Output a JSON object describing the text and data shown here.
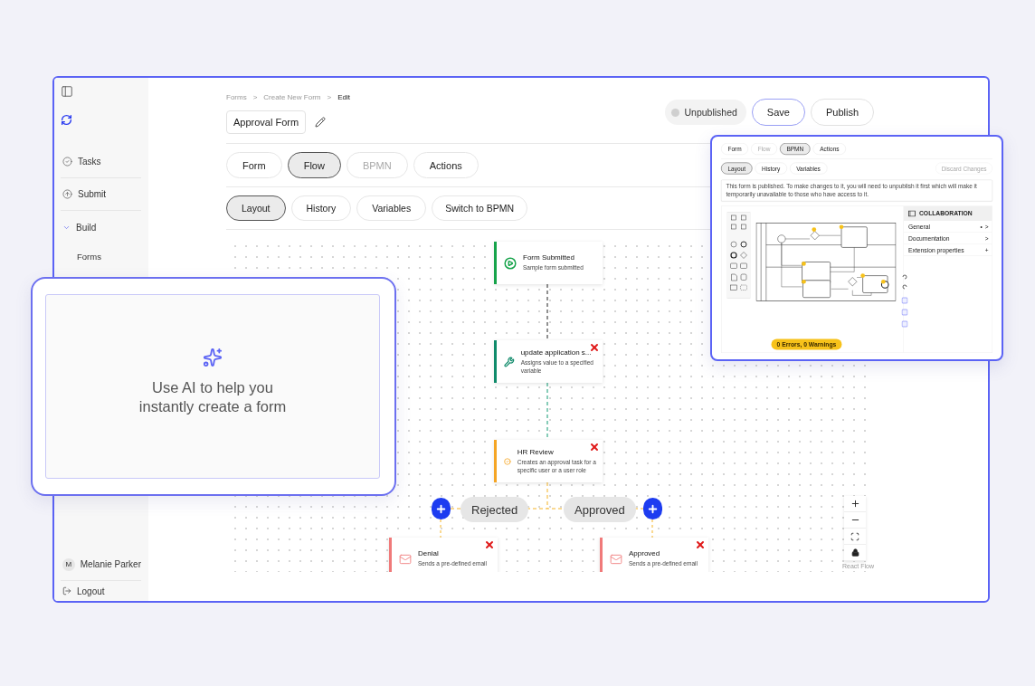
{
  "sidebar": {
    "items": [
      {
        "label": "Tasks"
      },
      {
        "label": "Submit"
      },
      {
        "label": "Build",
        "expanded": true,
        "children": [
          {
            "label": "Forms"
          }
        ]
      }
    ],
    "user": {
      "initial": "M",
      "name": "Melanie Parker"
    },
    "logout": "Logout"
  },
  "breadcrumb": {
    "items": [
      "Forms",
      "Create New Form",
      "Edit"
    ],
    "separator": ">"
  },
  "form_name": "Approval Form",
  "status": {
    "label": "Unpublished",
    "published": false
  },
  "buttons": [
    "Save",
    "Publish"
  ],
  "tabs": [
    {
      "label": "Form",
      "selected": false,
      "disabled": false
    },
    {
      "label": "Flow",
      "selected": true,
      "disabled": false
    },
    {
      "label": "BPMN",
      "selected": false,
      "disabled": true
    },
    {
      "label": "Actions",
      "selected": false,
      "disabled": false
    }
  ],
  "subtabs": [
    {
      "label": "Layout",
      "selected": true
    },
    {
      "label": "History",
      "selected": false
    },
    {
      "label": "Variables",
      "selected": false
    },
    {
      "label": "Switch to BPMN",
      "selected": false
    }
  ],
  "flow": {
    "nodes": [
      {
        "kind": "start",
        "title": "Form Submitted",
        "description": "Sample form submitted",
        "color": "#16a34a",
        "removable": false
      },
      {
        "kind": "assign",
        "title": "update application s...",
        "description": "Assigns value to a specified variable",
        "color": "#0f8a6a",
        "removable": true
      },
      {
        "kind": "approval",
        "title": "HR Review",
        "description": "Creates an approval task for a specific user or a user role",
        "color": "#f5a524",
        "removable": true
      },
      {
        "kind": "email",
        "title": "Denial",
        "description": "Sends a pre-defined email",
        "color": "#f07a7a",
        "removable": true
      },
      {
        "kind": "email",
        "title": "Approved",
        "description": "Sends a pre-defined email",
        "color": "#f07a7a",
        "removable": true
      }
    ],
    "branches": [
      {
        "label": "Rejected"
      },
      {
        "label": "Approved"
      }
    ],
    "attribution": "React Flow"
  },
  "ai_panel": {
    "lines": [
      "Use AI to help you",
      "instantly create a form"
    ]
  },
  "bpmn_preview": {
    "tabs": [
      {
        "label": "Form",
        "selected": false,
        "disabled": false
      },
      {
        "label": "Flow",
        "selected": false,
        "disabled": true
      },
      {
        "label": "BPMN",
        "selected": true,
        "disabled": false
      },
      {
        "label": "Actions",
        "selected": false,
        "disabled": false
      }
    ],
    "subtabs": [
      {
        "label": "Layout",
        "selected": true
      },
      {
        "label": "History",
        "selected": false
      },
      {
        "label": "Variables",
        "selected": false
      }
    ],
    "discard_button": {
      "label": "Discard Changes",
      "disabled": true
    },
    "notice": "This form is published. To make changes to it, you will need to unpublish it first which will make it temporarily unavailable to those who have access to it.",
    "properties": {
      "title": "COLLABORATION",
      "sections": [
        {
          "label": "General",
          "marker": "•",
          "control": ">"
        },
        {
          "label": "Documentation",
          "control": ">"
        },
        {
          "label": "Extension properties",
          "control": "+"
        }
      ]
    },
    "problems": "0 Errors, 0 Warnings"
  }
}
